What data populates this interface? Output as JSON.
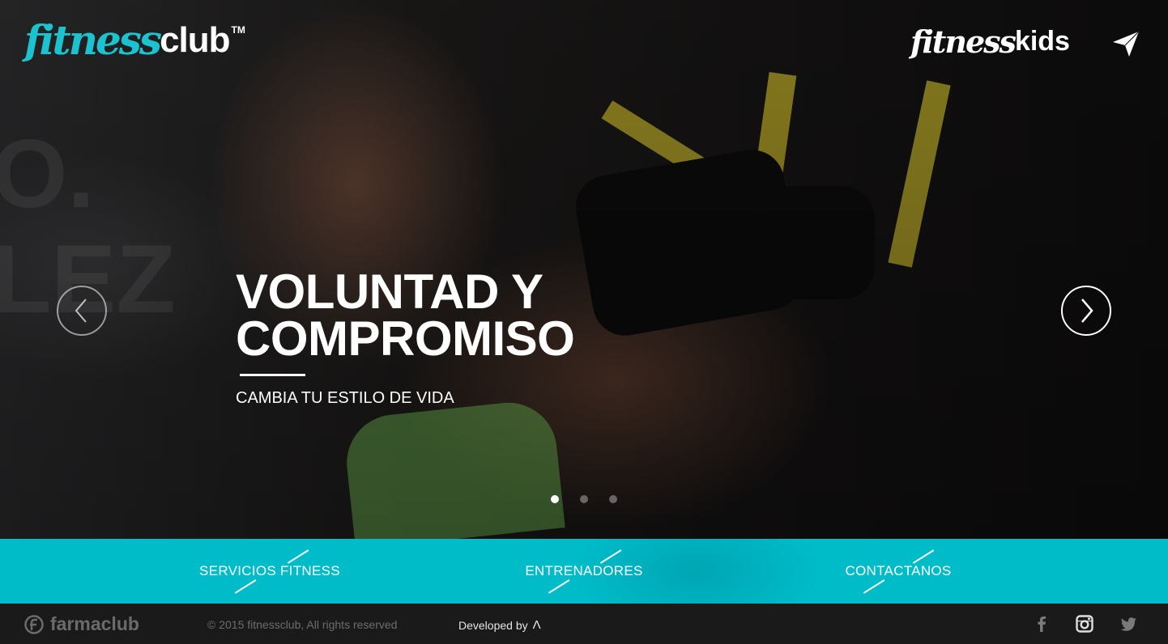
{
  "header": {
    "logo_fitness": "fitness",
    "logo_club": "club",
    "logo_tm": "TM",
    "kids_fitness": "fitness",
    "kids_kids": "kids",
    "contact_icon": "paper-plane-icon"
  },
  "slider": {
    "title_line1": "VOLUNTAD Y",
    "title_line2": "COMPROMISO",
    "subtitle": "CAMBIA TU ESTILO DE VIDA",
    "prev_icon": "chevron-left-icon",
    "next_icon": "chevron-right-icon",
    "slide_count": 3,
    "active_slide": 1
  },
  "nav": {
    "items": [
      {
        "label": "SERVICIOS FITNESS"
      },
      {
        "label": "ENTRENADORES"
      },
      {
        "label": "CONTACTANOS"
      }
    ]
  },
  "footer": {
    "brand": "farmaclub",
    "copyright": "© 2015 fitnessclub, All rights reserved",
    "developed_by": "Developed by",
    "developer_mark": "Λ",
    "social": [
      "facebook-icon",
      "instagram-icon",
      "twitter-icon"
    ]
  },
  "colors": {
    "accent": "#00bcc9",
    "logo_cyan": "#1cc3cf",
    "footer_bg": "#1a1a1a"
  }
}
